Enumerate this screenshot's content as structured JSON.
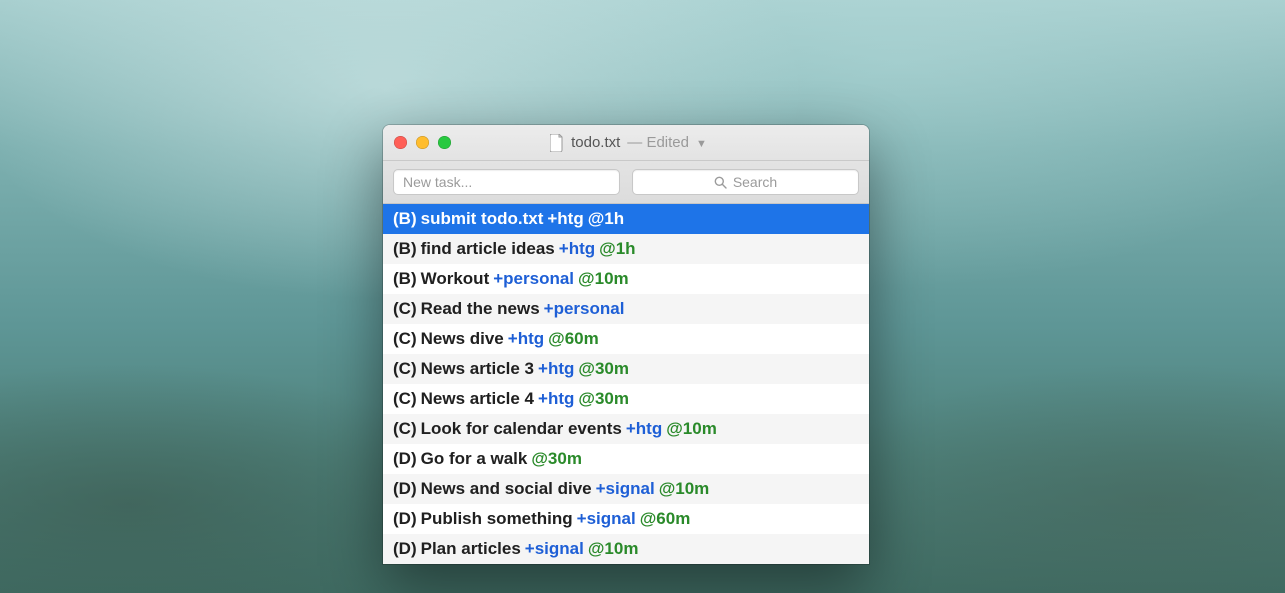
{
  "window": {
    "filename": "todo.txt",
    "status": "— Edited"
  },
  "toolbar": {
    "new_task_placeholder": "New task...",
    "search_placeholder": "Search"
  },
  "tasks": [
    {
      "priority": "(B)",
      "text": "submit todo.txt",
      "project": "+htg",
      "context": "@1h",
      "selected": true
    },
    {
      "priority": "(B)",
      "text": "find article ideas",
      "project": "+htg",
      "context": "@1h",
      "selected": false
    },
    {
      "priority": "(B)",
      "text": "Workout",
      "project": "+personal",
      "context": "@10m",
      "selected": false
    },
    {
      "priority": "(C)",
      "text": "Read the news",
      "project": "+personal",
      "context": "",
      "selected": false
    },
    {
      "priority": "(C)",
      "text": "News dive",
      "project": "+htg",
      "context": "@60m",
      "selected": false
    },
    {
      "priority": "(C)",
      "text": "News article 3",
      "project": "+htg",
      "context": "@30m",
      "selected": false
    },
    {
      "priority": "(C)",
      "text": "News article 4",
      "project": "+htg",
      "context": "@30m",
      "selected": false
    },
    {
      "priority": "(C)",
      "text": "Look for calendar events",
      "project": "+htg",
      "context": "@10m",
      "selected": false
    },
    {
      "priority": "(D)",
      "text": "Go for a walk",
      "project": "",
      "context": "@30m",
      "selected": false
    },
    {
      "priority": "(D)",
      "text": "News and social dive",
      "project": "+signal",
      "context": "@10m",
      "selected": false
    },
    {
      "priority": "(D)",
      "text": "Publish something",
      "project": "+signal",
      "context": "@60m",
      "selected": false
    },
    {
      "priority": "(D)",
      "text": "Plan articles",
      "project": "+signal",
      "context": "@10m",
      "selected": false
    }
  ]
}
